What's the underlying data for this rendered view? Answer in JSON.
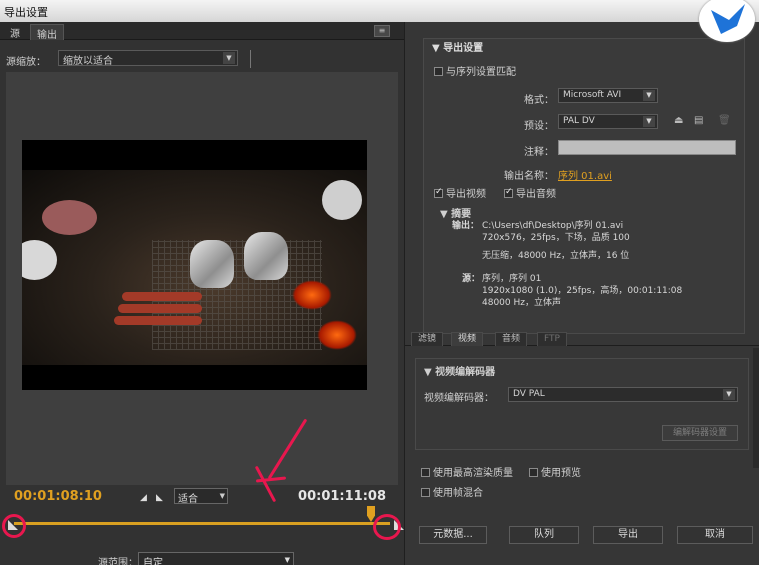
{
  "window": {
    "title": "导出设置"
  },
  "left": {
    "tabs": [
      "源",
      "输出"
    ],
    "active_tab": "输出",
    "menu_icon": "panel-menu-icon",
    "zoom": {
      "label": "源缩放：",
      "value": "缩放以适合"
    },
    "timecode_current": "00:01:08:10",
    "timecode_end": "00:01:11:08",
    "fit": "适合",
    "playhead_fraction": 0.96,
    "source_range": {
      "label": "源范围：",
      "value": "自定"
    }
  },
  "right": {
    "export_settings": {
      "header": "导出设置",
      "match_sequence": "与序列设置匹配",
      "format_label": "格式：",
      "format_value": "Microsoft AVI",
      "preset_label": "预设：",
      "preset_value": "PAL DV",
      "comment_label": "注释：",
      "output_name_label": "输出名称：",
      "output_name_value": "序列 01.avi",
      "export_video": "导出视频",
      "export_audio": "导出音频",
      "summary_header": "摘要",
      "output_label": "输出：",
      "output_line1": "C:\\Users\\df\\Desktop\\序列 01.avi",
      "output_line2": "720x576，25fps，下场，品质 100",
      "output_line3": "无压缩，48000 Hz，立体声，16 位",
      "source_label": "源：",
      "source_line1": "序列，序列 01",
      "source_line2": "1920x1080 (1.0)，25fps，高场，00:01:11:08",
      "source_line3": "48000 Hz，立体声"
    },
    "subtabs": [
      "滤镜",
      "视频",
      "音频",
      "FTP"
    ],
    "active_subtab": "视频",
    "codec_section": {
      "header": "视频编解码器",
      "codec_label": "视频编解码器：",
      "codec_value": "DV PAL",
      "codec_settings_button": "编解码器设置"
    },
    "options": {
      "max_render_quality": "使用最高渲染质量",
      "use_preview": "使用预览",
      "frame_blending": "使用帧混合"
    },
    "buttons": {
      "metadata": "元数据...",
      "queue": "队列",
      "export": "导出",
      "cancel": "取消"
    }
  },
  "colors": {
    "accent": "#e0a020",
    "annotation": "#e8174e"
  }
}
